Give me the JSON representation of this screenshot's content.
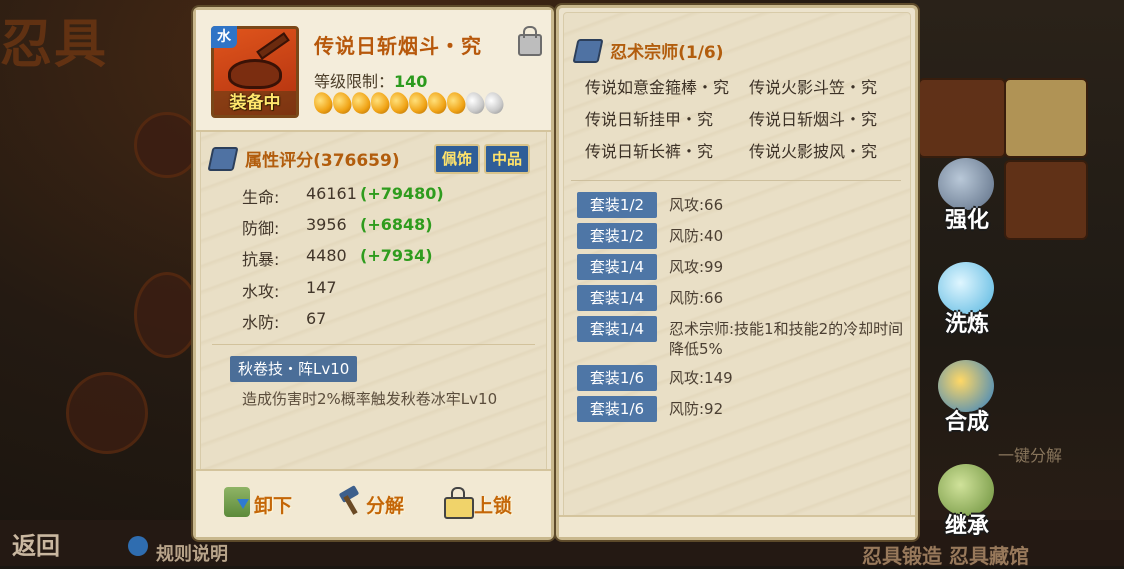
{
  "background": {
    "title_fragment": "忍具",
    "back_label": "返回",
    "rules_label": "规则说明",
    "bottom_right_label": "忍具锻造 忍具藏馆",
    "one_click_decompose": "一键分解"
  },
  "item": {
    "element_tag": "水",
    "status": "装备中",
    "name": "传说日斩烟斗・究",
    "level_label": "等级限制：",
    "level_value": "140",
    "beads_filled": 8,
    "beads_total": 10,
    "locked": false
  },
  "attributes": {
    "title": "属性评分(376659)",
    "tag_type": "佩饰",
    "tag_quality": "中品",
    "stats": [
      {
        "label": "生命:",
        "value": "46161",
        "bonus": "(+79480)"
      },
      {
        "label": "防御:",
        "value": "3956",
        "bonus": "(+6848)"
      },
      {
        "label": "抗暴:",
        "value": "4480",
        "bonus": "(+7934)"
      },
      {
        "label": "水攻:",
        "value": "147",
        "bonus": ""
      },
      {
        "label": "水防:",
        "value": "67",
        "bonus": ""
      }
    ]
  },
  "skill": {
    "name": "秋卷技・阵Lv10",
    "description": "造成伤害时2%概率触发秋卷冰牢Lv10"
  },
  "actions": {
    "unequip": "卸下",
    "decompose": "分解",
    "lock": "上锁"
  },
  "set": {
    "title": "忍术宗师(1/6)",
    "items": [
      "传说如意金箍棒・究",
      "传说火影斗笠・究",
      "传说日斩挂甲・究",
      "传说日斩烟斗・究",
      "传说日斩长裤・究",
      "传说火影披风・究"
    ],
    "bonuses": [
      {
        "tag": "套装1/2",
        "text": "风攻:66"
      },
      {
        "tag": "套装1/2",
        "text": "风防:40"
      },
      {
        "tag": "套装1/4",
        "text": "风攻:99"
      },
      {
        "tag": "套装1/4",
        "text": "风防:66"
      },
      {
        "tag": "套装1/4",
        "text": "忍术宗师:技能1和技能2的冷却时间降低5%"
      },
      {
        "tag": "套装1/6",
        "text": "风攻:149"
      },
      {
        "tag": "套装1/6",
        "text": "风防:92"
      }
    ]
  },
  "side_menu": {
    "strengthen": "强化",
    "refine": "洗炼",
    "combine": "合成",
    "inherit": "继承"
  },
  "colors": {
    "accent_orange": "#c46607",
    "bonus_green": "#2f9c1e",
    "tag_blue": "#4e76a6",
    "panel_bg": "#ece3cd"
  }
}
